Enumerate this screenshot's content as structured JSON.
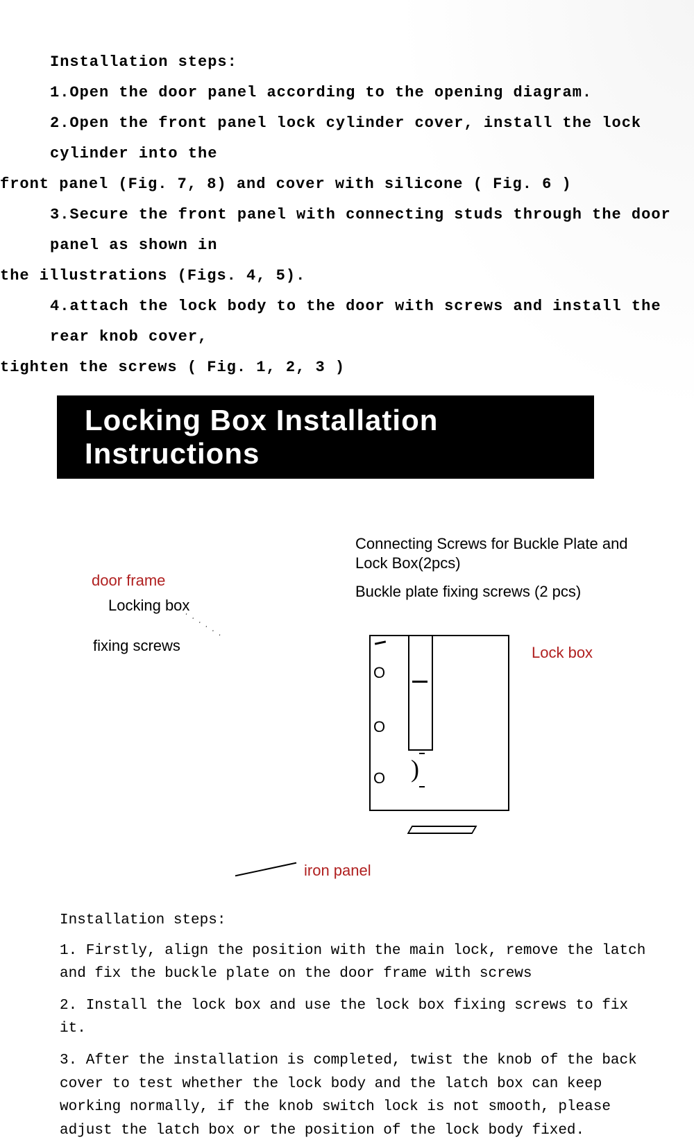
{
  "top_steps": {
    "heading": "Installation steps:",
    "s1": "1.Open the door panel according to the opening diagram.",
    "s2a": "2.Open the front panel lock cylinder cover, install the lock cylinder into the",
    "s2b": "front panel (Fig. 7, 8) and cover with silicone ( Fig. 6 )",
    "s3a": "3.Secure the front panel with connecting studs through the door panel as shown in",
    "s3b": "the illustrations (Figs. 4, 5).",
    "s4a": "4.attach the lock body to the door with screws and install the rear knob cover,",
    "s4b": "tighten the screws ( Fig. 1, 2, 3 )"
  },
  "banner": "Locking Box Installation  Instructions",
  "diagram": {
    "door_frame": "door frame",
    "locking_box": "Locking box",
    "fixing_screws": "fixing screws",
    "connecting_screws": "Connecting Screws for Buckle Plate and Lock Box(2pcs)",
    "buckle_plate": "Buckle plate fixing screws (2 pcs)",
    "lock_box": "Lock box",
    "iron_panel": "iron panel"
  },
  "bottom_steps": {
    "heading": "Installation steps:",
    "s1": "1. Firstly, align the position with the main lock, remove the latch and fix the buckle plate on the door frame with screws",
    "s2": "2. Install the lock box and use the lock box fixing screws to fix it.",
    "s3": "3. After the installation is completed, twist the knob of the back cover to test whether the lock body and the latch box can keep working normally, if the knob switch lock is not smooth, please adjust the latch box or the position of the lock body fixed."
  }
}
